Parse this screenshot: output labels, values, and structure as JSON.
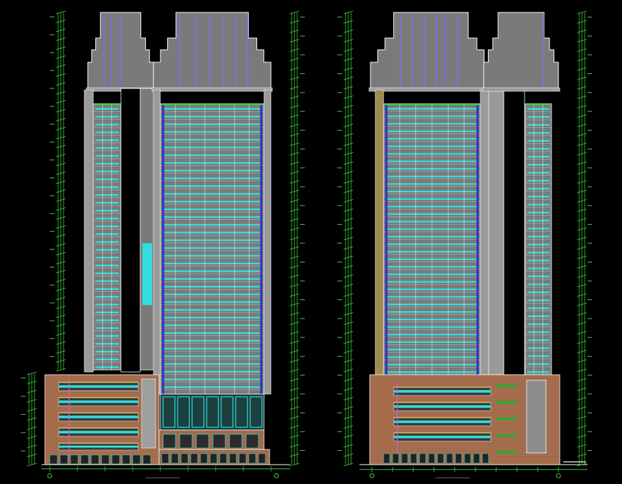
{
  "canvas": {
    "background": "#000000"
  },
  "colors": {
    "tower_fill": "#7a7a7a",
    "podium_brick": "#a0694a",
    "window": "#33dddd",
    "outline": "#ffffff",
    "dimension": "#3cd23c",
    "mullion_blue": "#2833c8",
    "crown_accent": "#7c70d8",
    "slab_yellow": "#d8c060"
  },
  "drawings": [
    {
      "name": "left-elevation",
      "title_label": ""
    },
    {
      "name": "right-elevation",
      "title_label": ""
    }
  ]
}
